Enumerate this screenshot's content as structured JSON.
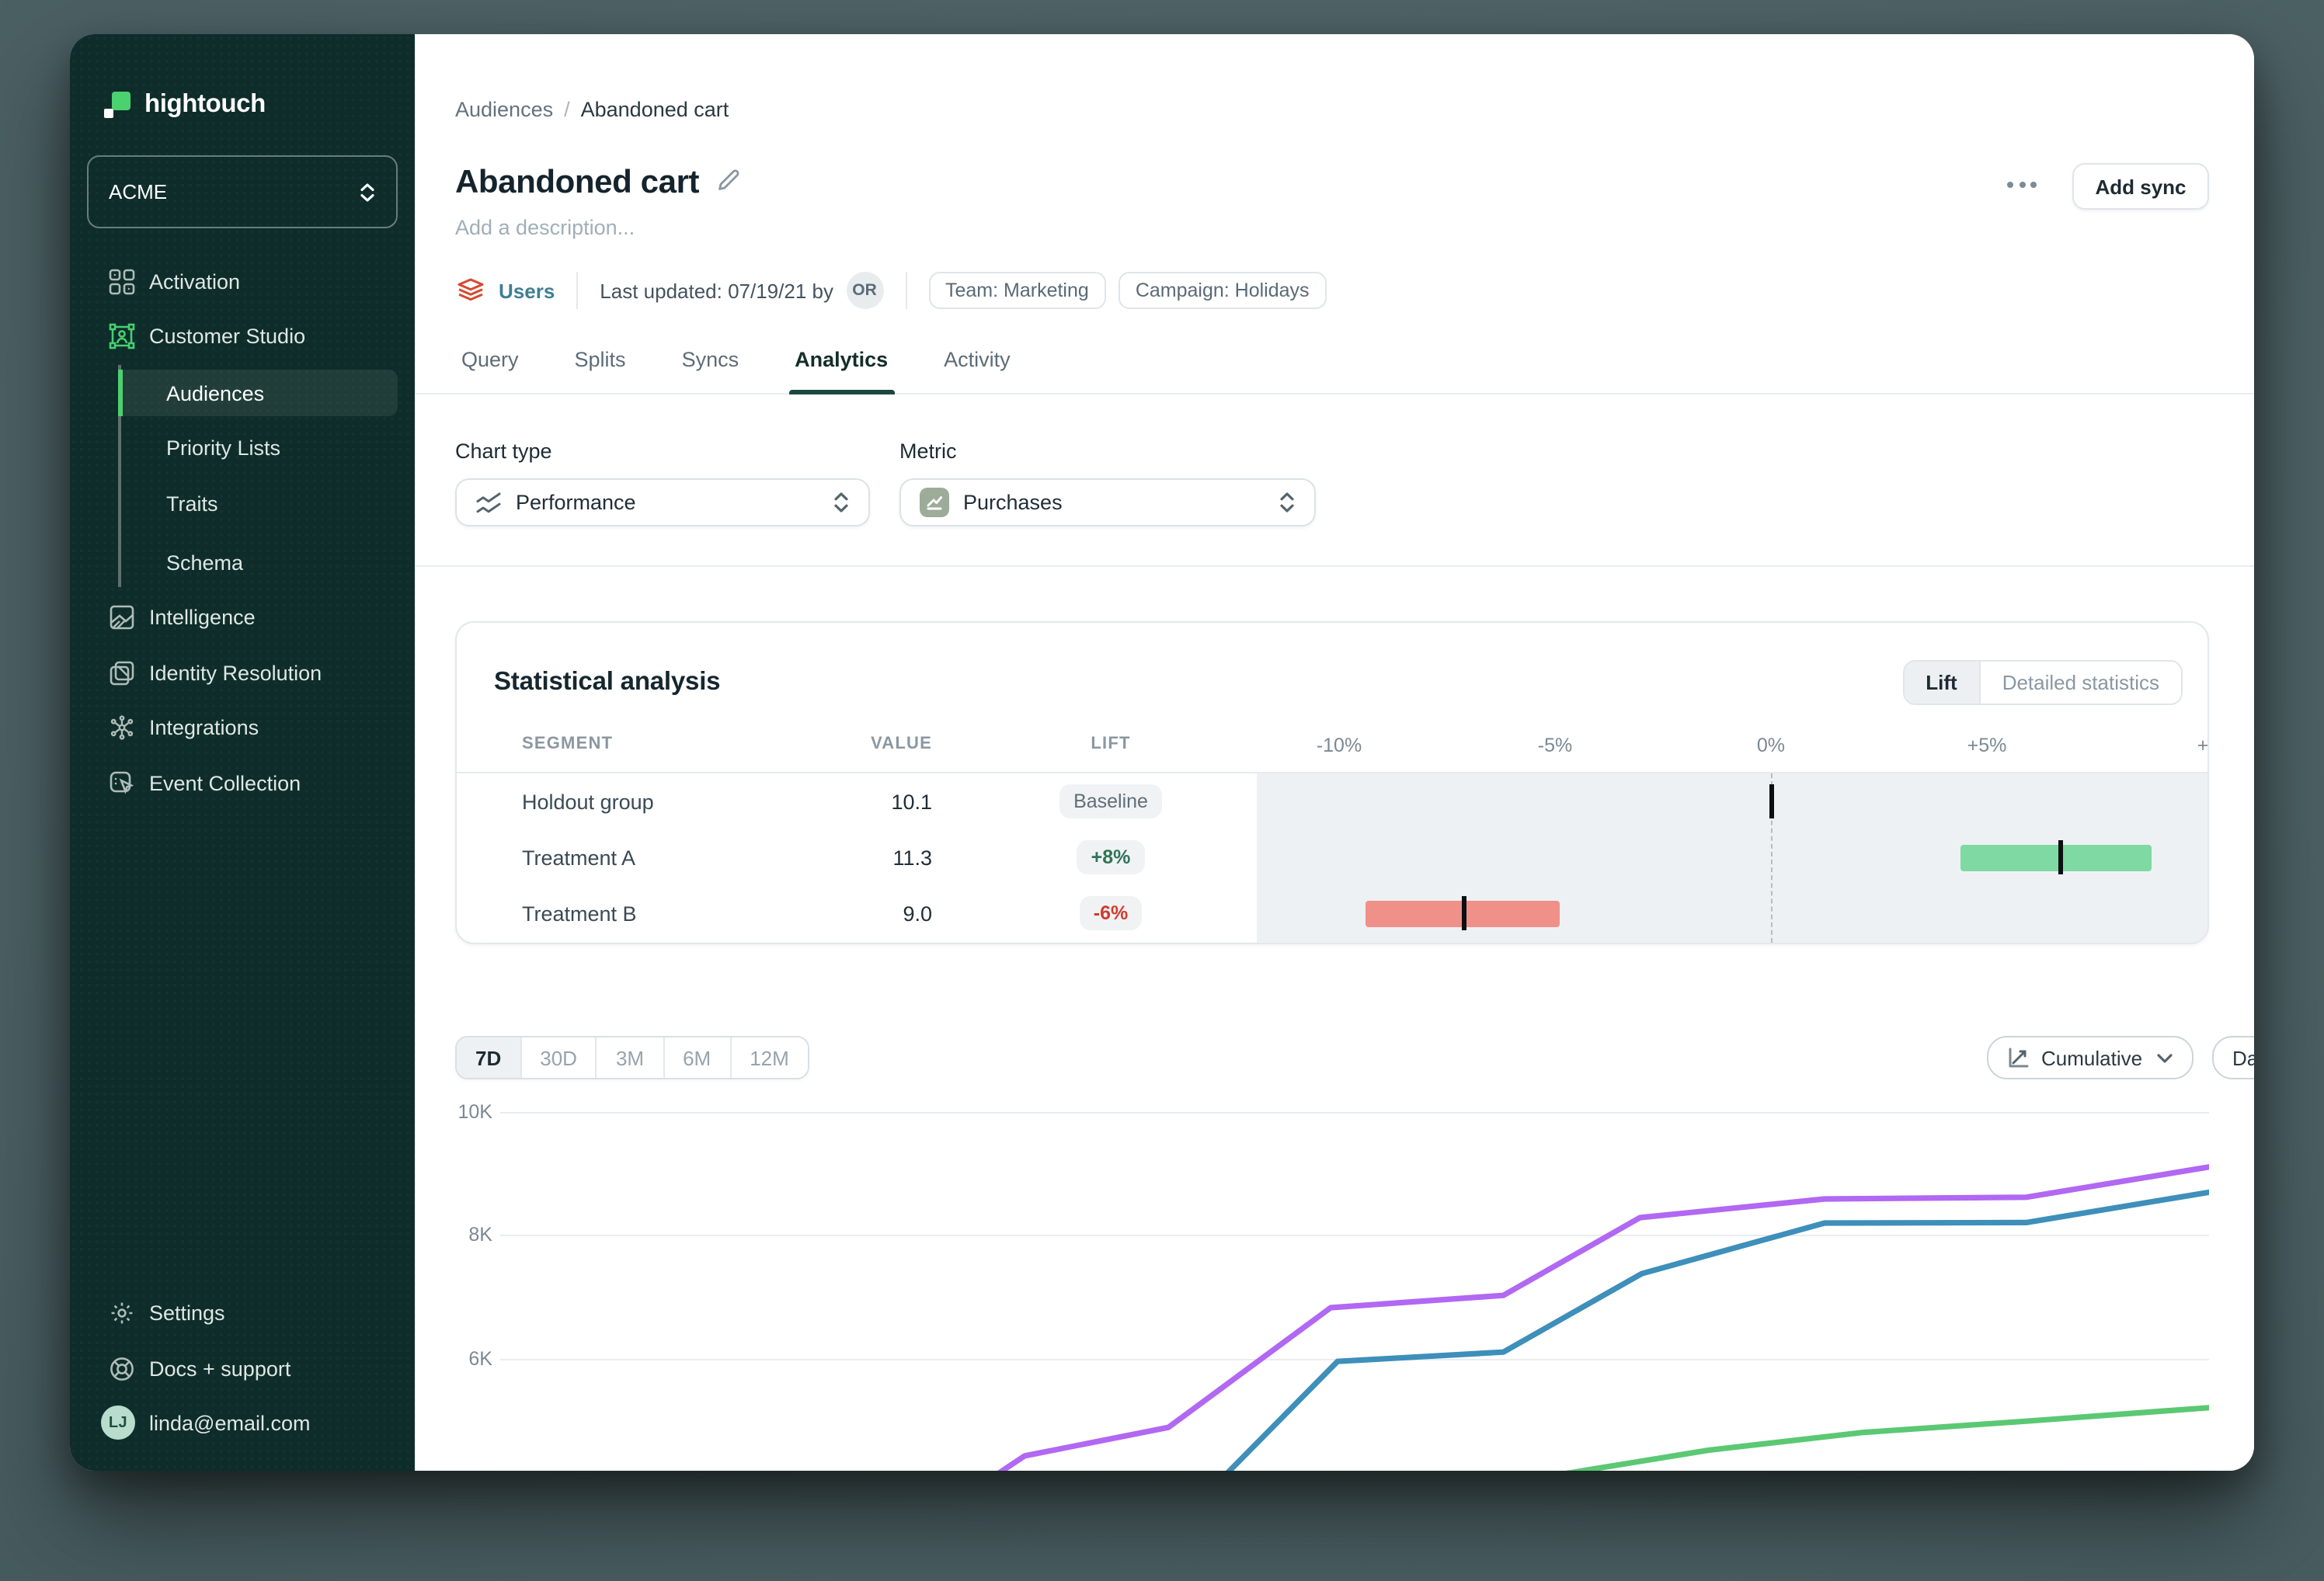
{
  "colors": {
    "backdrop": "#4a5f62",
    "sidebar_bg": "#0e2d2a",
    "accent_green": "#4bd16f",
    "users_teal": "#3f7f92",
    "source_icon_red": "#d6492f",
    "tab_underline": "#19493c",
    "lift_bar_positive": "#7ed9a2",
    "lift_bar_negative": "#f09189",
    "line_purple": "#b168f2",
    "line_blue": "#3e8fba",
    "line_green": "#5bc873"
  },
  "sidebar": {
    "logo_text": "hightouch",
    "workspace": "ACME",
    "nav": [
      {
        "label": "Activation"
      },
      {
        "label": "Customer Studio"
      },
      {
        "label": "Audiences",
        "active": true
      },
      {
        "label": "Priority Lists"
      },
      {
        "label": "Traits"
      },
      {
        "label": "Schema"
      },
      {
        "label": "Intelligence"
      },
      {
        "label": "Identity Resolution"
      },
      {
        "label": "Integrations"
      },
      {
        "label": "Event Collection"
      }
    ],
    "footer": {
      "settings": "Settings",
      "docs": "Docs + support",
      "user_initials": "LJ",
      "user_email": "linda@email.com"
    }
  },
  "header": {
    "breadcrumb": {
      "parent": "Audiences",
      "separator": "/",
      "current": "Abandoned cart"
    },
    "title": "Abandoned cart",
    "description_placeholder": "Add a description...",
    "source_label": "Users",
    "last_updated": "Last updated: 07/19/21 by",
    "updated_by_initials": "OR",
    "tags": [
      "Team: Marketing",
      "Campaign: Holidays"
    ],
    "add_sync_label": "Add sync"
  },
  "tabs": {
    "items": [
      "Query",
      "Splits",
      "Syncs",
      "Analytics",
      "Activity"
    ],
    "active": "Analytics"
  },
  "filters": {
    "chart_type_label": "Chart type",
    "chart_type_value": "Performance",
    "metric_label": "Metric",
    "metric_value": "Purchases"
  },
  "stat_card": {
    "title": "Statistical analysis",
    "toggle": {
      "lift": "Lift",
      "detailed": "Detailed statistics",
      "active": "Lift"
    },
    "columns": {
      "segment": "SEGMENT",
      "value": "VALUE",
      "lift": "LIFT"
    },
    "axis": [
      "-10%",
      "-5%",
      "0%",
      "+5%",
      "+"
    ],
    "rows": [
      {
        "segment": "Holdout group",
        "value": "10.1",
        "lift": "Baseline",
        "tone": "neutral",
        "tick_pct": 0
      },
      {
        "segment": "Treatment A",
        "value": "11.3",
        "lift": "+8%",
        "tone": "positive",
        "bar_pct": [
          4.4,
          8.8
        ],
        "tick_pct": 6.7,
        "bar_color": "#7ed9a2"
      },
      {
        "segment": "Treatment B",
        "value": "9.0",
        "lift": "-6%",
        "tone": "negative",
        "bar_pct": [
          -9.4,
          -4.9
        ],
        "tick_pct": -7.1,
        "bar_color": "#f09189"
      }
    ]
  },
  "chart_controls": {
    "ranges": [
      "7D",
      "30D",
      "3M",
      "6M",
      "12M"
    ],
    "active_range": "7D",
    "mode_select": "Cumulative",
    "granularity_select": "Daily"
  },
  "chart_data": [
    {
      "type": "bar",
      "subtype": "horizontal-lift-intervals",
      "title": "Statistical analysis — Lift",
      "axis_tick_labels": [
        "-10%",
        "-5%",
        "0%",
        "+5%",
        "+"
      ],
      "axis_range_pct": [
        -11.5,
        10
      ],
      "rows": [
        {
          "segment": "Holdout group",
          "value": 10.1,
          "lift_label": "Baseline",
          "point_pct": 0
        },
        {
          "segment": "Treatment A",
          "value": 11.3,
          "lift_label": "+8%",
          "interval_pct": [
            4.4,
            8.8
          ],
          "point_pct": 6.7
        },
        {
          "segment": "Treatment B",
          "value": 9.0,
          "lift_label": "-6%",
          "interval_pct": [
            -9.4,
            -4.9
          ],
          "point_pct": -7.1
        }
      ]
    },
    {
      "type": "line",
      "title": "Purchases — cumulative, daily, 7D",
      "ytick_labels": [
        "10K",
        "8K",
        "6K"
      ],
      "y_gridlines": [
        10000,
        8000,
        6000
      ],
      "y_top_visible": 10000,
      "y_bottom_cutoff": 4200,
      "x_unit": "fraction of visible 7-day window (x-axis labels cut off in screenshot)",
      "series": [
        {
          "name": "purple",
          "color": "#b168f2",
          "points": [
            [
              0.288,
              4080
            ],
            [
              0.307,
              4430
            ],
            [
              0.391,
              4890
            ],
            [
              0.486,
              6830
            ],
            [
              0.587,
              7030
            ],
            [
              0.667,
              8290
            ],
            [
              0.775,
              8590
            ],
            [
              0.893,
              8620
            ],
            [
              1.0,
              9110
            ]
          ]
        },
        {
          "name": "blue",
          "color": "#3e8fba",
          "points": [
            [
              0.423,
              4080
            ],
            [
              0.49,
              5960
            ],
            [
              0.587,
              6110
            ],
            [
              0.668,
              7380
            ],
            [
              0.775,
              8200
            ],
            [
              0.893,
              8210
            ],
            [
              1.0,
              8700
            ]
          ]
        },
        {
          "name": "green",
          "color": "#5bc873",
          "points": [
            [
              0.59,
              3980
            ],
            [
              0.605,
              4060
            ],
            [
              0.707,
              4520
            ],
            [
              0.798,
              4810
            ],
            [
              0.893,
              4990
            ],
            [
              1.0,
              5210
            ]
          ]
        }
      ]
    }
  ]
}
